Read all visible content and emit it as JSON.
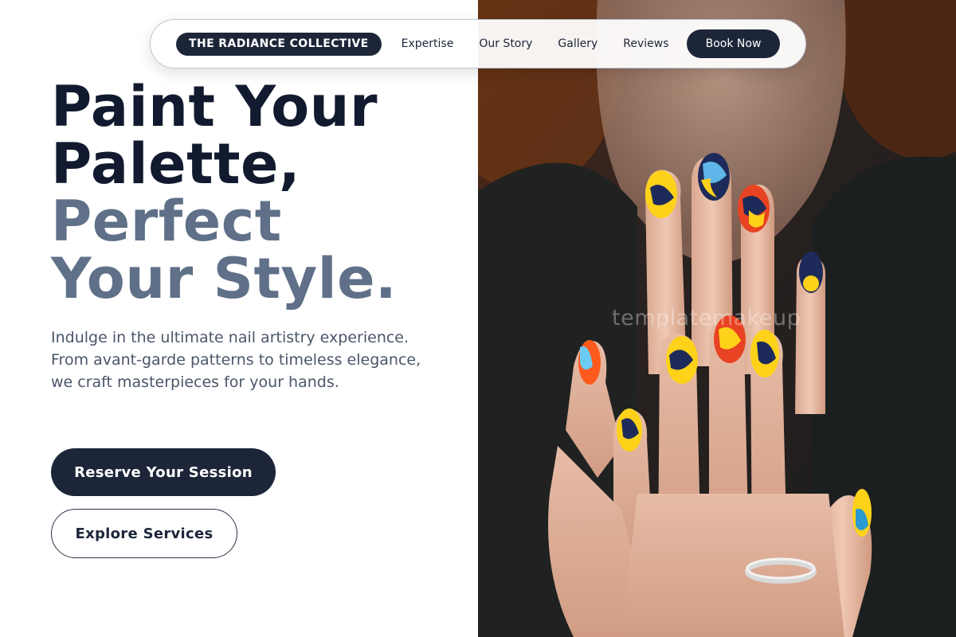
{
  "nav": {
    "brand": "THE RADIANCE COLLECTIVE",
    "links": [
      "Expertise",
      "Our Story",
      "Gallery",
      "Reviews"
    ],
    "cta": "Book Now"
  },
  "hero": {
    "headline_dark": [
      "Paint Your",
      "Palette,"
    ],
    "headline_muted": [
      "Perfect",
      "Your Style."
    ],
    "description": "Indulge in the ultimate nail artistry experience. From avant-garde patterns to timeless elegance, we craft masterpieces for your hands.",
    "primary_cta": "Reserve Your Session",
    "secondary_cta": "Explore Services"
  },
  "photo": {
    "watermark": "templatemakeup"
  },
  "colors": {
    "navy": "#1d2639",
    "headline_dark": "#111a2e",
    "headline_muted": "#5f7088",
    "body_text": "#4a5669"
  }
}
